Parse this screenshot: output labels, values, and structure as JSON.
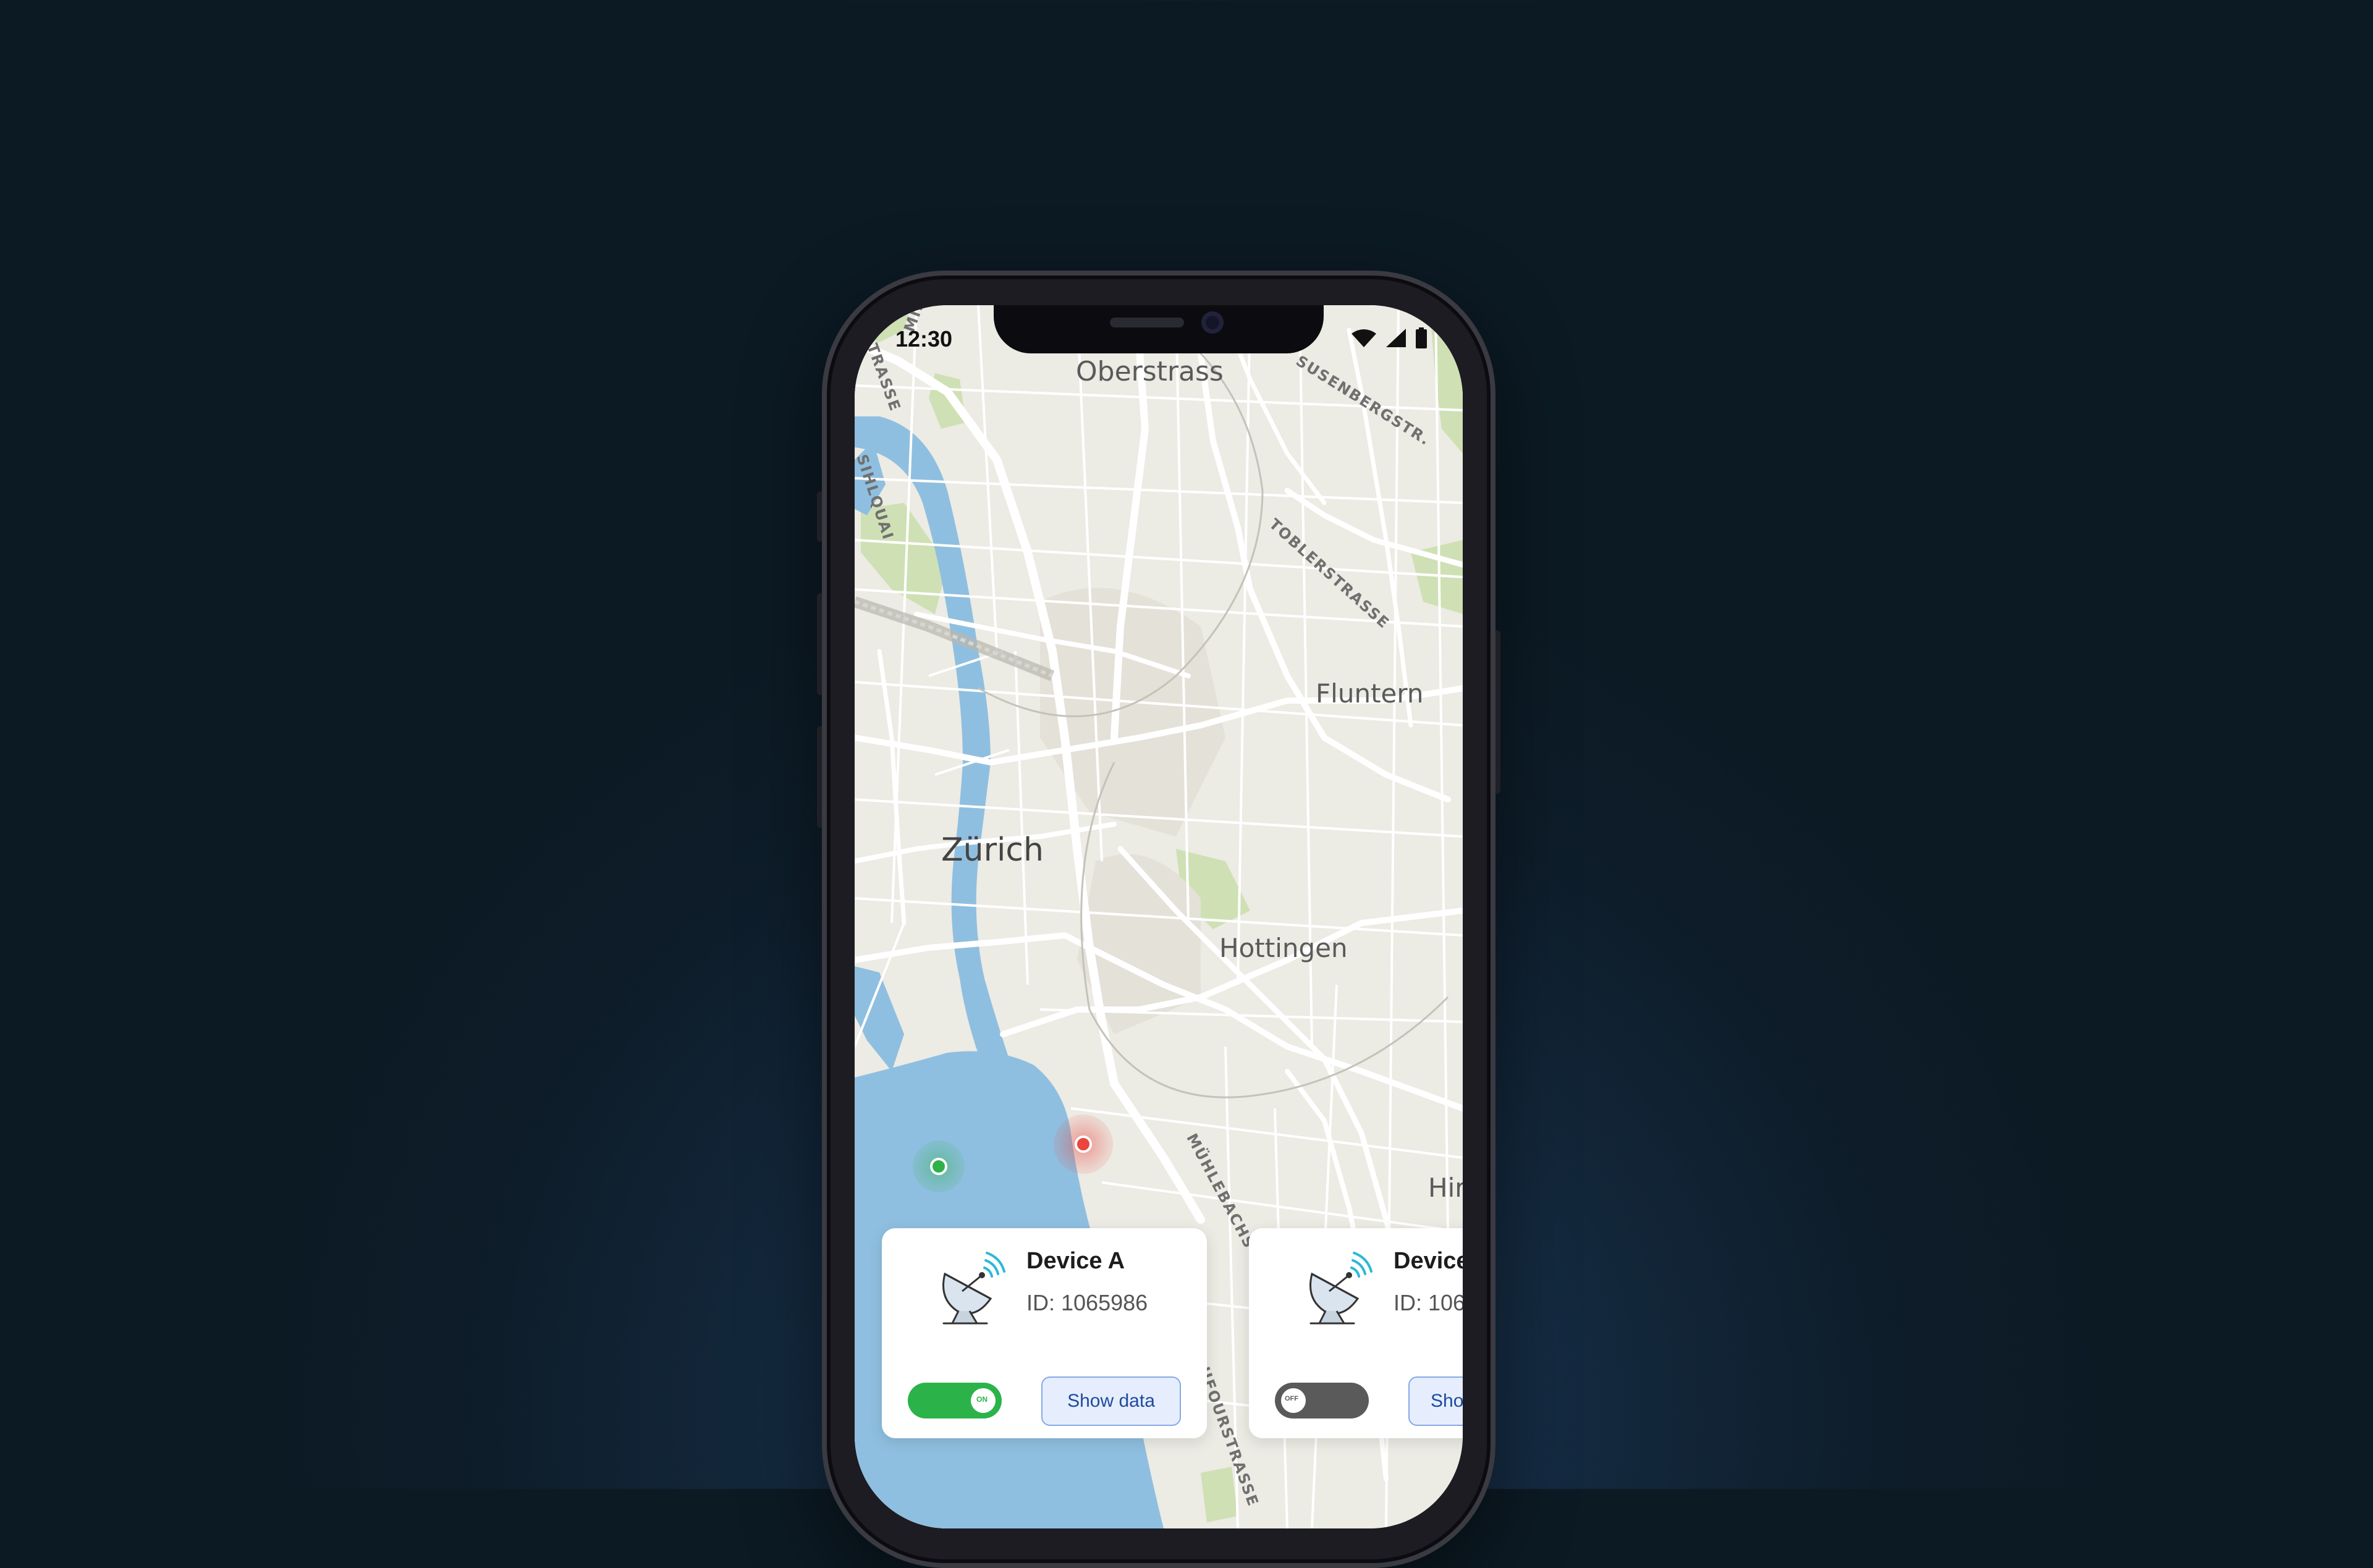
{
  "status_bar": {
    "time": "12:30",
    "icons": [
      "wifi-icon",
      "signal-icon",
      "battery-icon"
    ]
  },
  "map": {
    "places": {
      "oberstrass": "Oberstrass",
      "fluntern": "Fluntern",
      "zurich": "Zürich",
      "hottingen": "Hottingen",
      "hir": "Hir"
    },
    "streets": {
      "susenberg": "SUSENBERGSTR.",
      "tobler": "TOBLERSTRASSE",
      "sihlquai": "SIHLQUAI",
      "strasse_top": "STRASSE",
      "mil": "MIL",
      "muehlebach": "MÜHLEBACHS",
      "dufour": "DUFOURSTRASSE"
    },
    "colors": {
      "land": "#ecebe4",
      "water": "#8fbfe0",
      "park": "#cfe0b4",
      "roads": "#ffffff"
    },
    "markers": [
      {
        "name": "green-marker",
        "color": "#2fb14a"
      },
      {
        "name": "red-marker",
        "color": "#e8463f"
      }
    ]
  },
  "devices": [
    {
      "name": "Device A",
      "id": "ID: 1065986",
      "toggle_label": "ON",
      "toggle_on": true,
      "button": "Show data"
    },
    {
      "name": "Device",
      "id": "ID: 106",
      "toggle_label": "OFF",
      "toggle_on": false,
      "button": "Sho"
    }
  ],
  "colors": {
    "toggle_on": "#2bb34a",
    "toggle_off": "#5a5a5a",
    "button_bg": "#e6eefd",
    "button_border": "#86a9e8",
    "button_text": "#1f4aa0"
  }
}
